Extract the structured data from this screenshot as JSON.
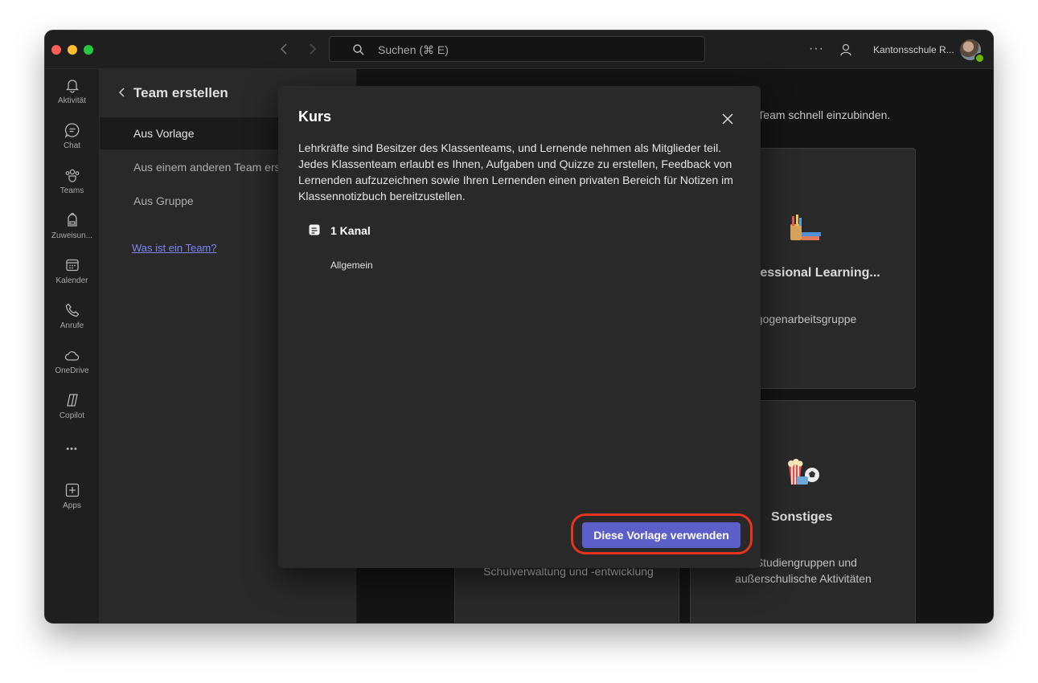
{
  "titlebar": {
    "search_placeholder": "Suchen (⌘ E)",
    "more": "···",
    "org_name": "Kantonsschule R..."
  },
  "rail": {
    "items": [
      {
        "label": "Aktivität",
        "icon": "bell-icon"
      },
      {
        "label": "Chat",
        "icon": "chat-icon"
      },
      {
        "label": "Teams",
        "icon": "teams-icon"
      },
      {
        "label": "Zuweisun...",
        "icon": "backpack-icon"
      },
      {
        "label": "Kalender",
        "icon": "calendar-icon"
      },
      {
        "label": "Anrufe",
        "icon": "phone-icon"
      },
      {
        "label": "OneDrive",
        "icon": "cloud-icon"
      },
      {
        "label": "Copilot",
        "icon": "copilot-icon"
      },
      {
        "label": "•••",
        "icon": "more-icon"
      },
      {
        "label": "Apps",
        "icon": "add-app-icon"
      }
    ]
  },
  "left_panel": {
    "title": "Team erstellen",
    "items": [
      "Aus Vorlage",
      "Aus einem anderen Team erstellen",
      "Aus Gruppe"
    ],
    "link": "Was ist ein Team?"
  },
  "main": {
    "intro_text": "r Team schnell einzubinden.",
    "cards": [
      {
        "title": "fessional Learning...",
        "desc": "agogenarbeitsgruppe"
      },
      {
        "title": "Sonstiges",
        "desc": ", Studiengruppen und außerschulische Aktivitäten"
      },
      {
        "title": "",
        "desc": "Schulverwaltung und -entwicklung"
      }
    ]
  },
  "dialog": {
    "title": "Kurs",
    "description": "Lehrkräfte sind Besitzer des Klassenteams, und Lernende nehmen als Mitglieder teil. Jedes Klassenteam erlaubt es Ihnen, Aufgaben und Quizze zu erstellen, Feedback von Lernenden aufzuzeichnen sowie Ihren Lernenden einen privaten Bereich für Notizen im Klassennotizbuch bereitzustellen.",
    "channel_count": "1 Kanal",
    "channel_name": "Allgemein",
    "use_button": "Diese Vorlage verwenden"
  },
  "colors": {
    "accent": "#5b5fc7",
    "highlight": "#e8331f",
    "link": "#7f85f5"
  }
}
